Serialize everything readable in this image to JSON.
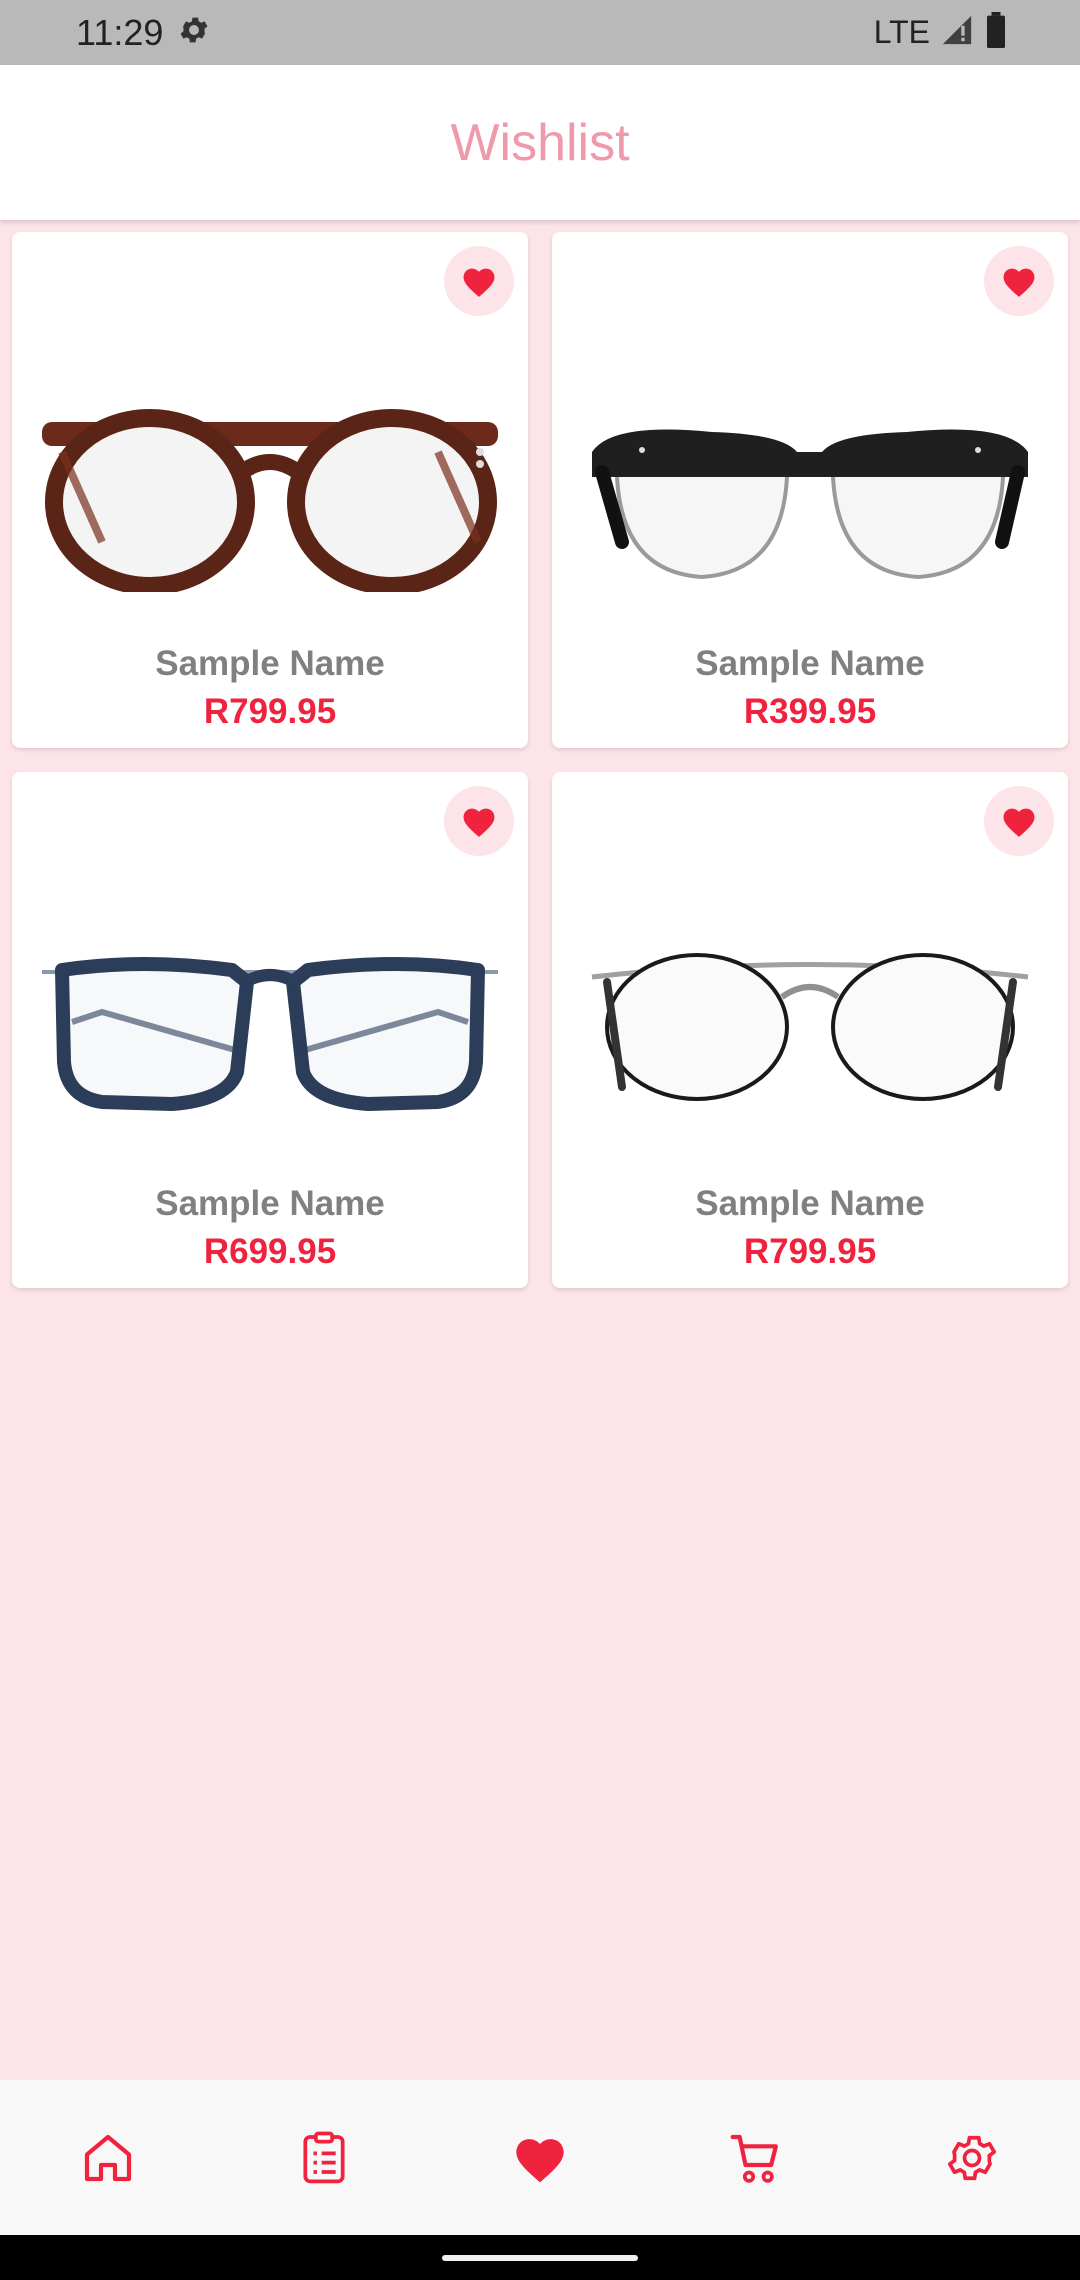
{
  "status_bar": {
    "time": "11:29",
    "network": "LTE",
    "icons": [
      "settings-icon",
      "signal-icon",
      "battery-icon"
    ]
  },
  "header": {
    "title": "Wishlist"
  },
  "colors": {
    "accent": "#f0233f",
    "title_pink": "#ee9aab",
    "background": "#fde4e8",
    "name_gray": "#808080"
  },
  "products": [
    {
      "name": "Sample Name",
      "price": "R799.95",
      "image": "tortoiseshell-round-glasses"
    },
    {
      "name": "Sample Name",
      "price": "R399.95",
      "image": "black-browline-glasses"
    },
    {
      "name": "Sample Name",
      "price": "R699.95",
      "image": "navy-square-glasses"
    },
    {
      "name": "Sample Name",
      "price": "R799.95",
      "image": "silver-wire-round-glasses"
    }
  ],
  "bottom_nav": {
    "items": [
      "home-icon",
      "orders-icon",
      "heart-icon",
      "cart-icon",
      "settings-icon"
    ],
    "active": "heart-icon"
  }
}
